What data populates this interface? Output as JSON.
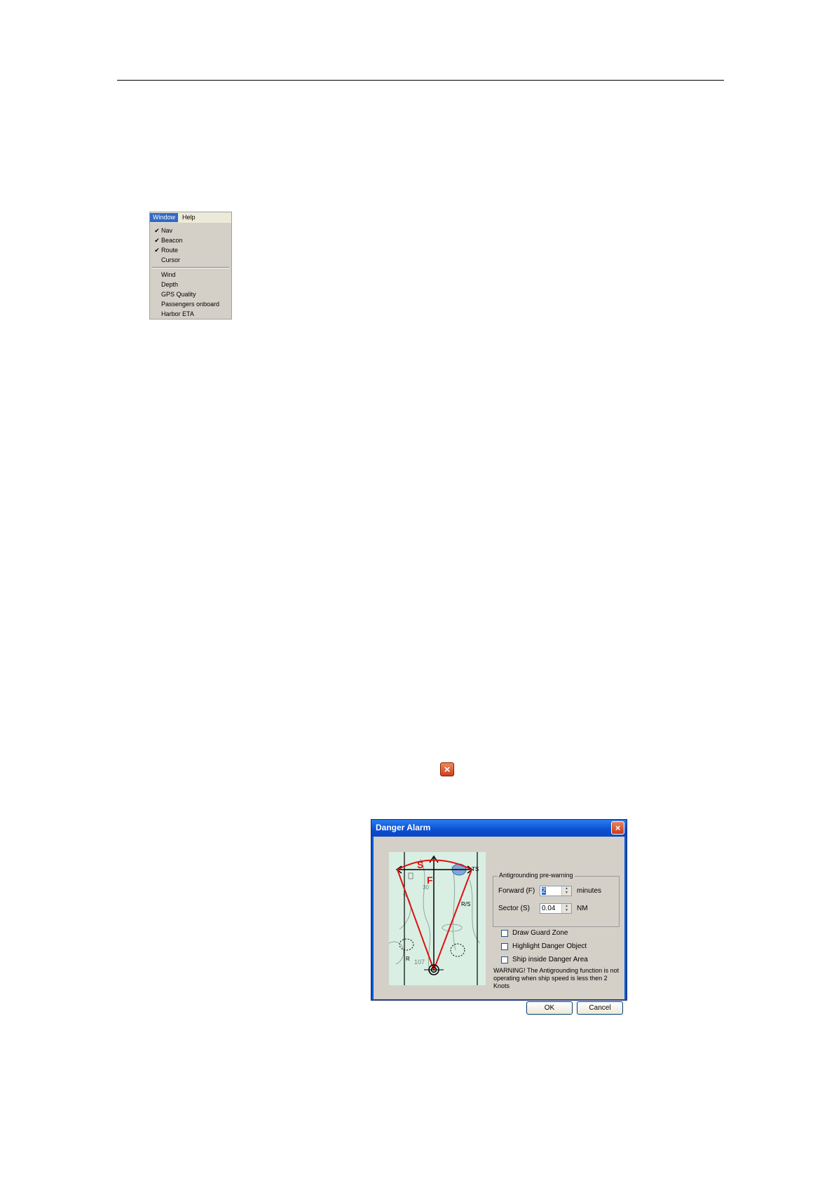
{
  "menu": {
    "tabs": [
      "Window",
      "Help"
    ],
    "items": [
      {
        "label": "Nav",
        "checked": true
      },
      {
        "label": "Beacon",
        "checked": true
      },
      {
        "label": "Route",
        "checked": true
      },
      {
        "label": "Cursor",
        "checked": false
      },
      {
        "label": "Wind",
        "checked": false
      },
      {
        "label": "Depth",
        "checked": false
      },
      {
        "label": "GPS Quality",
        "checked": false
      },
      {
        "label": "Passengers onboard",
        "checked": false
      },
      {
        "label": "Harbor ETA",
        "checked": false
      }
    ],
    "check_glyph": "✔"
  },
  "close_icon": "×",
  "dialog": {
    "title": "Danger Alarm",
    "group_title": "Antigrounding pre-warning",
    "forward": {
      "label": "Forward (F)",
      "value": "2",
      "unit": "minutes"
    },
    "sector": {
      "label": "Sector (S)",
      "value": "0.04",
      "unit": "NM"
    },
    "checkboxes": [
      "Draw Guard Zone",
      "Highlight Danger Object",
      "Ship inside Danger Area"
    ],
    "warning": "WARNING! The Antigrounding function is not operating when ship speed is less then 2 Knots",
    "ok": "OK",
    "cancel": "Cancel",
    "map": {
      "label_s": "S",
      "label_f": "F",
      "label_ts": "TS",
      "depth_a": "30",
      "depth_b": "107",
      "mark_r": "R",
      "mark_rs": "R/S"
    }
  }
}
